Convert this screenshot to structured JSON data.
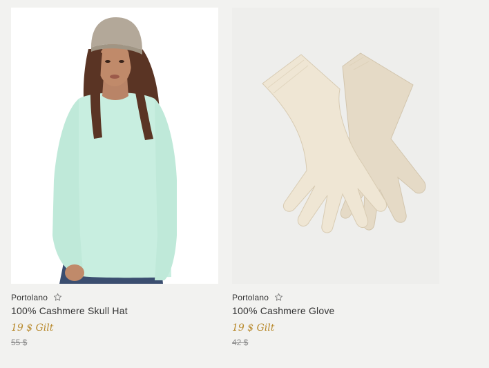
{
  "products": [
    {
      "brand": "Portolano",
      "name": "100% Cashmere Skull Hat",
      "price": "19 $ Gilt",
      "original_price": "55 $",
      "favorite_icon": "star-outline-icon",
      "image": "model-in-mint-sweater-and-beige-hat"
    },
    {
      "brand": "Portolano",
      "name": "100% Cashmere Glove",
      "price": "19 $ Gilt",
      "original_price": "42 $",
      "favorite_icon": "star-outline-icon",
      "image": "beige-cashmere-gloves"
    }
  ],
  "colors": {
    "background": "#f2f2f0",
    "price_accent": "#b8892b",
    "old_price": "#8a8a8a",
    "text": "#333333"
  }
}
